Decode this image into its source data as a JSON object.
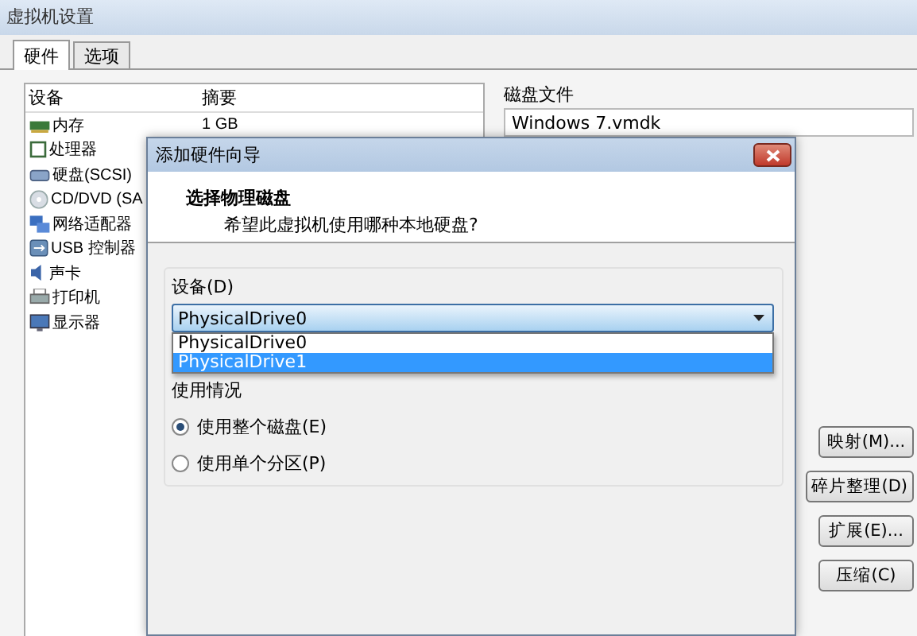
{
  "window": {
    "title": "虚拟机设置"
  },
  "tabs": [
    {
      "label": "硬件",
      "selected": true
    },
    {
      "label": "选项",
      "selected": false
    }
  ],
  "device_table": {
    "columns": [
      "设备",
      "摘要"
    ],
    "rows": [
      {
        "device": "内存",
        "summary": "1 GB"
      },
      {
        "device": "处理器"
      },
      {
        "device": "硬盘(SCSI)"
      },
      {
        "device": "CD/DVD (SA"
      },
      {
        "device": "网络适配器"
      },
      {
        "device": "USB 控制器"
      },
      {
        "device": "声卡"
      },
      {
        "device": "打印机"
      },
      {
        "device": "显示器"
      }
    ]
  },
  "disk_file": {
    "label": "磁盘文件",
    "value": "Windows 7.vmdk"
  },
  "side_buttons": [
    "映射(M)...",
    "碎片整理(D)",
    "扩展(E)...",
    "压缩(C)"
  ],
  "dialog": {
    "title": "添加硬件向导",
    "heading": "选择物理磁盘",
    "subtitle": "希望此虚拟机使用哪种本地硬盘?",
    "device_label": "设备(D)",
    "device_value": "PhysicalDrive0",
    "dropdown_options": [
      {
        "label": "PhysicalDrive0",
        "selected": false
      },
      {
        "label": "PhysicalDrive1",
        "selected": true
      }
    ],
    "usage_label": "使用情况",
    "usage_options": [
      {
        "label": "使用整个磁盘(E)",
        "selected": true
      },
      {
        "label": "使用单个分区(P)",
        "selected": false
      }
    ]
  }
}
